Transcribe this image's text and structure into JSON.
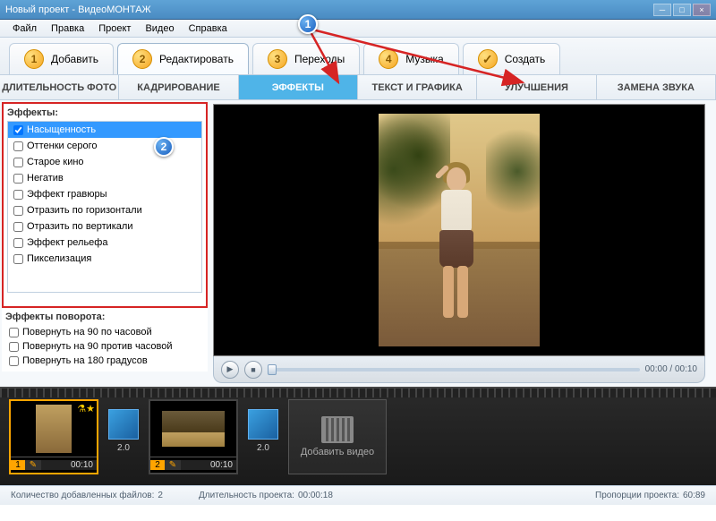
{
  "window": {
    "title": "Новый проект - ВидеоМОНТАЖ"
  },
  "menu": {
    "file": "Файл",
    "edit": "Правка",
    "project": "Проект",
    "video": "Видео",
    "help": "Справка"
  },
  "toptabs": {
    "add": "Добавить",
    "editing": "Редактировать",
    "transitions": "Переходы",
    "music": "Музыка",
    "create": "Создать",
    "num1": "1",
    "num2": "2",
    "num3": "3",
    "num4": "4",
    "check": "✓"
  },
  "subtabs": {
    "photo_duration": "ДЛИТЕЛЬНОСТЬ ФОТО",
    "crop": "КАДРИРОВАНИЕ",
    "effects": "ЭФФЕКТЫ",
    "text": "ТЕКСТ И ГРАФИКА",
    "enhance": "УЛУЧШЕНИЯ",
    "audio": "ЗАМЕНА ЗВУКА"
  },
  "effects": {
    "title": "Эффекты:",
    "items": [
      {
        "label": "Насыщенность",
        "checked": true,
        "selected": true
      },
      {
        "label": "Оттенки серого",
        "checked": false,
        "selected": false
      },
      {
        "label": "Старое кино",
        "checked": false,
        "selected": false
      },
      {
        "label": "Негатив",
        "checked": false,
        "selected": false
      },
      {
        "label": "Эффект гравюры",
        "checked": false,
        "selected": false
      },
      {
        "label": "Отразить по горизонтали",
        "checked": false,
        "selected": false
      },
      {
        "label": "Отразить по вертикали",
        "checked": false,
        "selected": false
      },
      {
        "label": "Эффект рельефа",
        "checked": false,
        "selected": false
      },
      {
        "label": "Пикселизация",
        "checked": false,
        "selected": false
      }
    ]
  },
  "rotations": {
    "title": "Эффекты поворота:",
    "items": [
      {
        "label": "Повернуть на 90 по часовой"
      },
      {
        "label": "Повернуть на 90 против часовой"
      },
      {
        "label": "Повернуть на 180 градусов"
      }
    ]
  },
  "player": {
    "time": "00:00 / 00:10"
  },
  "timeline": {
    "clips": [
      {
        "index": "1",
        "time": "00:10"
      },
      {
        "index": "2",
        "time": "00:10"
      }
    ],
    "transition_label": "2.0",
    "add_label": "Добавить видео"
  },
  "status": {
    "files_label": "Количество добавленных файлов:",
    "files_value": "2",
    "duration_label": "Длительность проекта:",
    "duration_value": "00:00:18",
    "ratio_label": "Пропорции проекта:",
    "ratio_value": "60:89"
  },
  "annotations": {
    "one": "1",
    "two": "2"
  }
}
